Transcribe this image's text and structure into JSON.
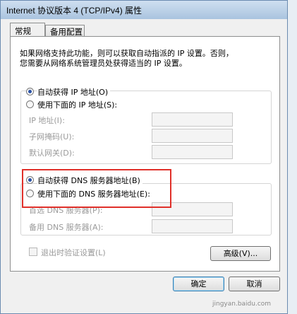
{
  "window": {
    "title": "Internet 协议版本 4 (TCP/IPv4) 属性"
  },
  "tabs": [
    {
      "label": "常规"
    },
    {
      "label": "备用配置"
    }
  ],
  "description": {
    "line1": "如果网络支持此功能，则可以获取自动指派的 IP 设置。否则，",
    "line2": "您需要从网络系统管理员处获得适当的 IP 设置。"
  },
  "ip": {
    "auto_label": "自动获得 IP 地址(O)",
    "manual_label": "使用下面的 IP 地址(S):",
    "selected": "auto",
    "fields": [
      {
        "label": "IP 地址(I):",
        "value": ""
      },
      {
        "label": "子网掩码(U):",
        "value": ""
      },
      {
        "label": "默认网关(D):",
        "value": ""
      }
    ]
  },
  "dns": {
    "auto_label": "自动获得 DNS 服务器地址(B)",
    "manual_label": "使用下面的 DNS 服务器地址(E):",
    "selected": "auto",
    "fields": [
      {
        "label": "首选 DNS 服务器(P):",
        "value": ""
      },
      {
        "label": "备用 DNS 服务器(A):",
        "value": ""
      }
    ]
  },
  "validate": {
    "label": "退出时验证设置(L)",
    "checked": false
  },
  "buttons": {
    "advanced": "高级(V)...",
    "ok": "确定",
    "cancel": "取消"
  },
  "watermark": "jingyan.baidu.com",
  "colors": {
    "highlight_box": "#e0302a",
    "radio_dot": "#2a52a6"
  }
}
